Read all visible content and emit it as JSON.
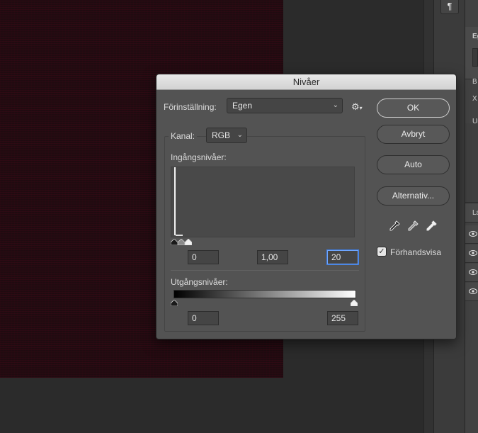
{
  "dialog": {
    "title": "Nivåer",
    "preset_label": "Förinställning:",
    "preset_value": "Egen",
    "channel_label": "Kanal:",
    "channel_value": "RGB",
    "input_levels_label": "Ingångsnivåer:",
    "input_black": "0",
    "input_gamma": "1,00",
    "input_white": "20",
    "output_levels_label": "Utgångsnivåer:",
    "output_black": "0",
    "output_white": "255",
    "buttons": {
      "ok": "OK",
      "cancel": "Avbryt",
      "auto": "Auto",
      "options": "Alternativ..."
    },
    "preview_label": "Förhandsvisa",
    "preview_checked": true
  },
  "right_panel": {
    "strip_button_icon": "paragraph-icon",
    "texts": [
      "Eg",
      "B",
      "X",
      "Up",
      "La"
    ]
  },
  "colors": {
    "dialog_bg": "#535353",
    "canvas_image": "#1f0b10",
    "focus_ring": "#6ea6ff"
  }
}
